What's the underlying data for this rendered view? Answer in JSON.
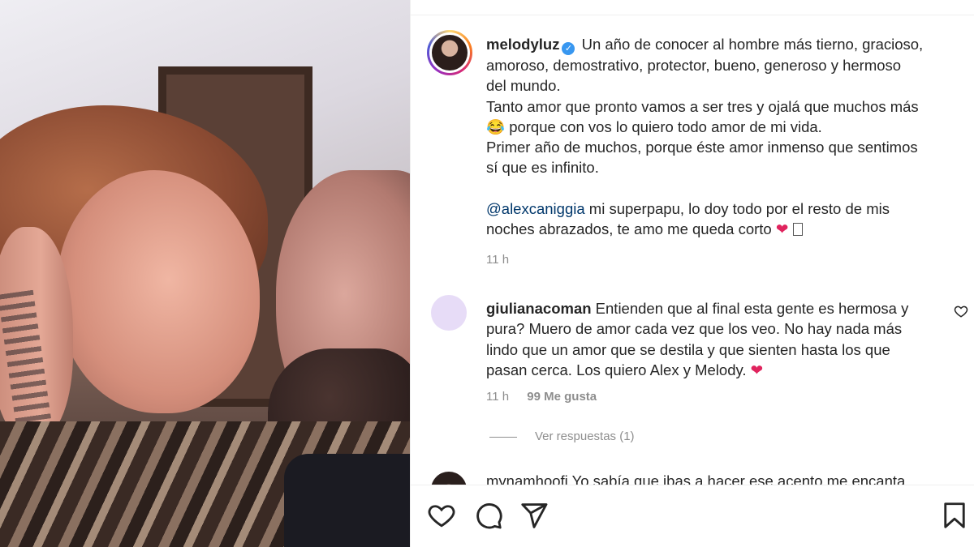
{
  "post": {
    "username": "melodyluz",
    "verified_mark": "✓",
    "caption_lines": [
      "Un año de conocer al hombre más tierno, gracioso,",
      "amoroso, demostrativo, protector, bueno, generoso y hermoso",
      "del mundo.",
      "Tanto amor que pronto vamos a ser tres y ojalá que muchos más",
      "porque con vos lo quiero todo amor de mi vida.",
      "Primer año de muchos, porque éste amor inmenso que sentimos",
      "sí que es infinito."
    ],
    "emoji_laugh": "😂",
    "mention": "@alexcaniggia",
    "mention_text_1": " mi superpapu, lo doy todo por el resto de mis",
    "mention_text_2": "noches abrazados, te amo me queda corto ",
    "heart": "❤",
    "time": "11 h"
  },
  "comment": {
    "username": "giulianacoman",
    "text_1": "Entienden que al final esta gente es hermosa y",
    "text_2": "pura? Muero de amor cada vez que los veo. No hay nada más",
    "text_3": "lindo que un amor que se destila y que sienten hasta los que",
    "text_4": "pasan cerca. Los quiero Alex y Melody. ",
    "heart": "❤",
    "time": "11 h",
    "likes": "99 Me gusta",
    "replies_label": "Ver respuestas (1)"
  },
  "next_comment_peek": "mynamhoofi  Yo sabía que ibas a hacer ese acento me encanta",
  "icons": {
    "like": "heart-outline-icon",
    "comment": "comment-bubble-icon",
    "share": "paper-plane-icon",
    "save": "bookmark-icon"
  },
  "colors": {
    "text": "#262626",
    "muted": "#8e8e8e",
    "mention": "#00376b",
    "verified": "#3897f0",
    "heart": "#e0245e"
  }
}
